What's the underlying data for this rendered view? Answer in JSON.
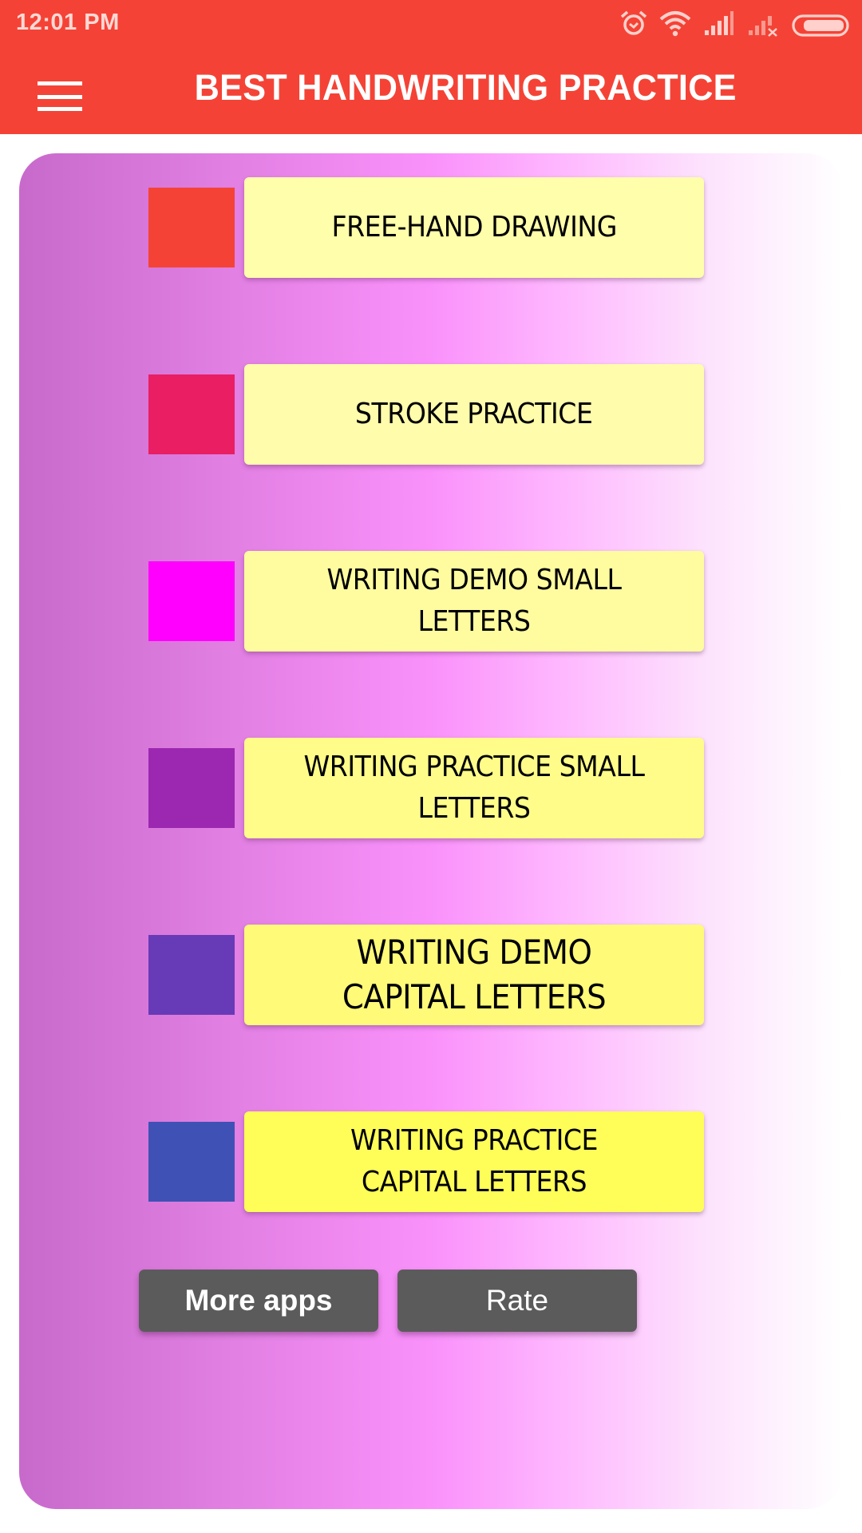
{
  "status_bar": {
    "time": "12:01 PM",
    "icons": [
      "alarm-icon",
      "wifi-icon",
      "signal-icon",
      "signal-no-sim-icon",
      "battery-icon"
    ]
  },
  "app_bar": {
    "menu_icon": "hamburger-menu-icon",
    "title": "BEST HANDWRITING PRACTICE",
    "color": "#f44336"
  },
  "menu": {
    "items": [
      {
        "label": "FREE-HAND DRAWING",
        "swatch_color": "#f44336",
        "button_color": "#fffeaa"
      },
      {
        "label": "STROKE PRACTICE",
        "swatch_color": "#e91e63",
        "button_color": "#fffcac"
      },
      {
        "label": "WRITING DEMO SMALL LETTERS",
        "swatch_color": "#ff00ff",
        "button_color": "#fffc9f"
      },
      {
        "label": "WRITING PRACTICE SMALL LETTERS",
        "swatch_color": "#9c27b0",
        "button_color": "#fffc8a"
      },
      {
        "label": "WRITING DEMO CAPITAL LETTERS",
        "swatch_color": "#673ab7",
        "button_color": "#fffa78"
      },
      {
        "label": "WRITING PRACTICE CAPITAL LETTERS",
        "swatch_color": "#3f51b5",
        "button_color": "#fffd58"
      }
    ]
  },
  "actions": {
    "more_apps": "More apps",
    "rate": "Rate"
  }
}
